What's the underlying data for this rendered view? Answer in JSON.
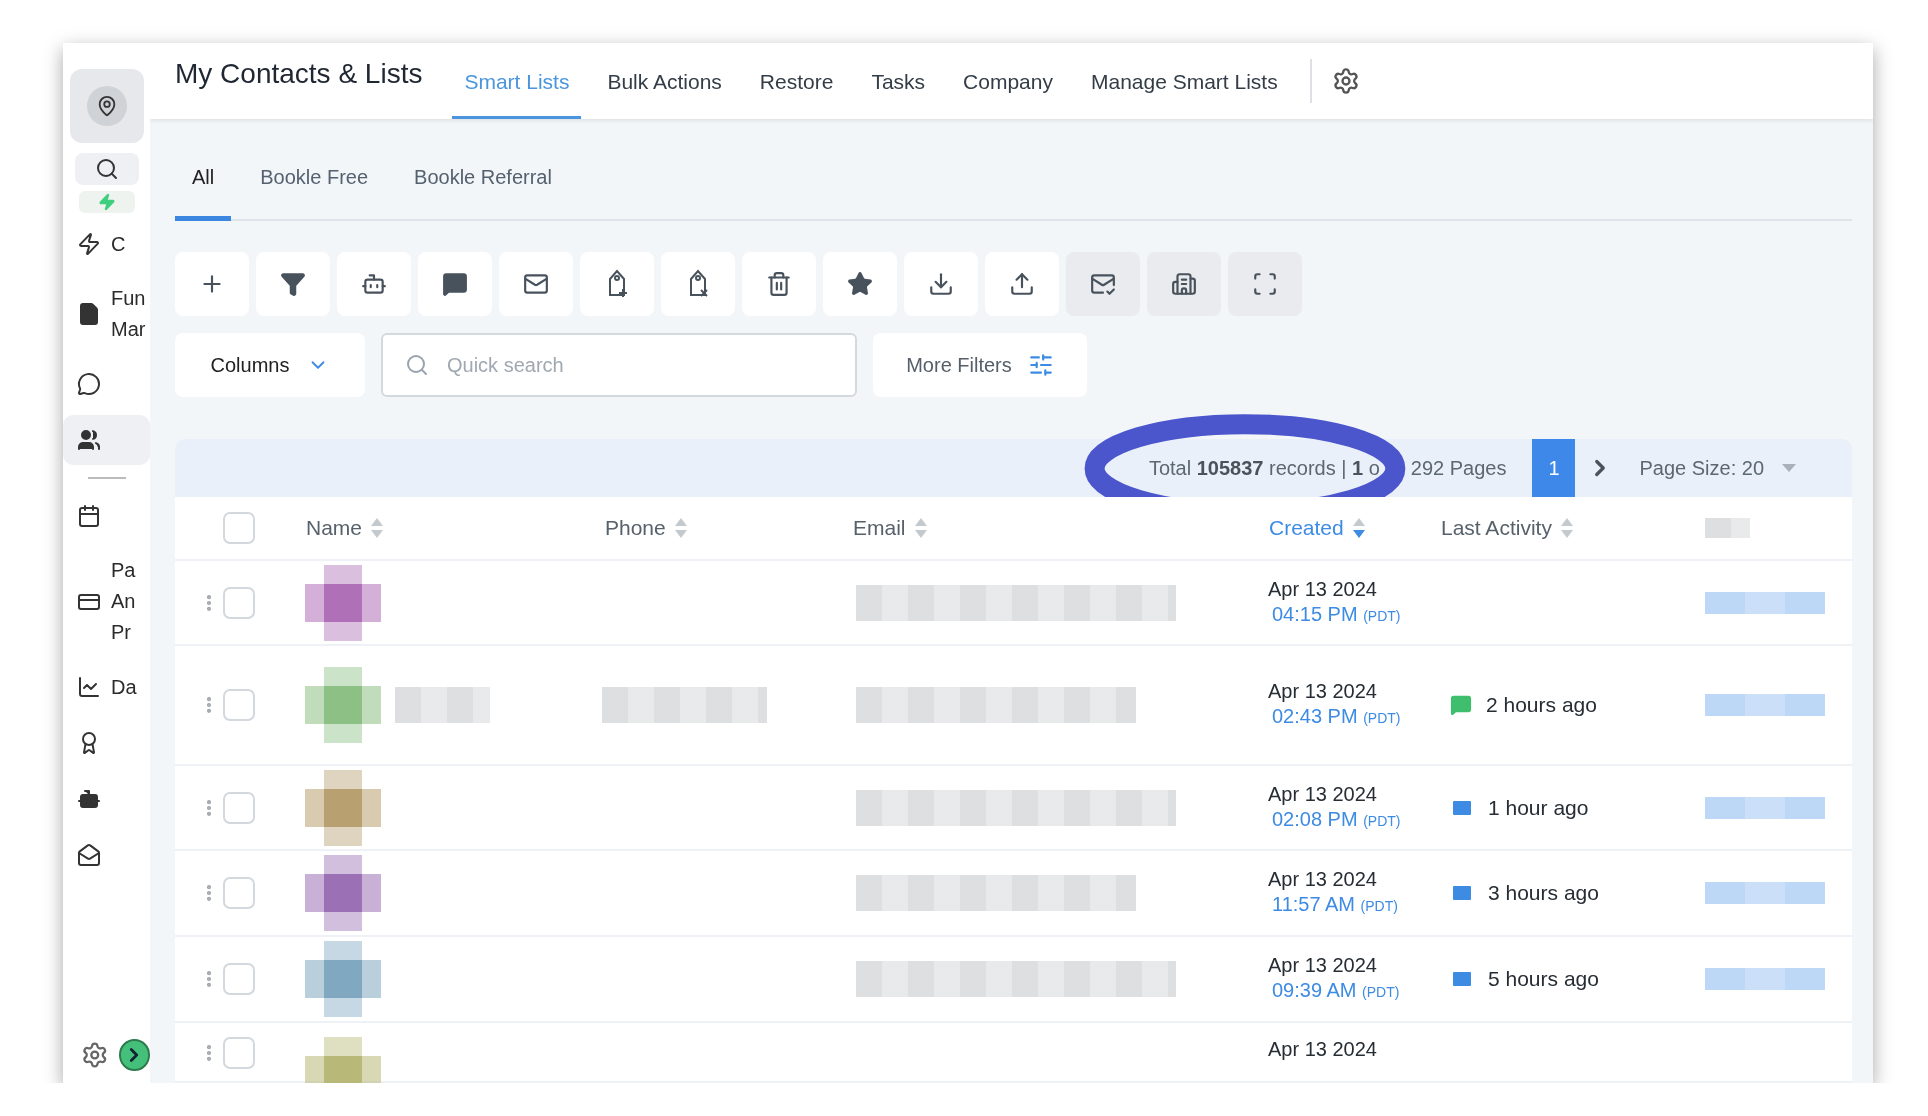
{
  "sidebar": {
    "nav": [
      {
        "lines": [
          "C"
        ],
        "selected": false
      },
      {
        "lines": [
          "Fun",
          "Mar"
        ],
        "selected": false
      },
      {
        "selected": false
      },
      {
        "selected": true
      },
      {
        "selected": false
      },
      {
        "lines": [
          "Pa",
          "An",
          "Pr"
        ],
        "selected": false
      },
      {
        "lines": [
          "Da"
        ],
        "selected": false
      },
      {
        "selected": false
      },
      {
        "selected": false
      },
      {
        "selected": false
      }
    ]
  },
  "header": {
    "title": "My Contacts & Lists",
    "tabs": [
      {
        "label": "Smart Lists",
        "selected": true
      },
      {
        "label": "Bulk Actions",
        "selected": false
      },
      {
        "label": "Restore",
        "selected": false
      },
      {
        "label": "Tasks",
        "selected": false
      },
      {
        "label": "Company",
        "selected": false
      },
      {
        "label": "Manage Smart Lists",
        "selected": false
      }
    ]
  },
  "list_tabs": [
    {
      "label": "All",
      "selected": true
    },
    {
      "label": "Bookle Free",
      "selected": false
    },
    {
      "label": "Bookle Referral",
      "selected": false
    }
  ],
  "toolbar": [
    {
      "shaded": false
    },
    {
      "shaded": false
    },
    {
      "shaded": false
    },
    {
      "shaded": false
    },
    {
      "shaded": false
    },
    {
      "shaded": false
    },
    {
      "shaded": false
    },
    {
      "shaded": false
    },
    {
      "shaded": false
    },
    {
      "shaded": false
    },
    {
      "shaded": false
    },
    {
      "shaded": true
    },
    {
      "shaded": true
    },
    {
      "shaded": true
    }
  ],
  "filters": {
    "columns_label": "Columns",
    "search_placeholder": "Quick search",
    "more_filters": "More Filters"
  },
  "pagination": {
    "summary": "Total **105837** records | **1** o",
    "pages": "292 Pages",
    "page": "1",
    "page_size": "Page Size: 20"
  },
  "annotation": {
    "kind": "ellipse"
  },
  "table": {
    "select_all_checked": false,
    "columns": [
      {
        "label": "Name",
        "sorted": false
      },
      {
        "label": "Phone",
        "sorted": false
      },
      {
        "label": "Email",
        "sorted": false
      },
      {
        "label": "Created",
        "sorted": true
      },
      {
        "label": "Last Activity",
        "sorted": false
      }
    ],
    "rows": [
      {
        "checked": false,
        "color": "#b070b8",
        "date": "Apr 13 2024",
        "time": "04:15 PM",
        "tz": "(PDT)"
      },
      {
        "checked": false,
        "color": "#8cc084",
        "name_redacted": true,
        "phone_redacted": true,
        "date": "Apr 13 2024",
        "time": "02:43 PM",
        "tz": "(PDT)",
        "activity": {
          "kind": "sms",
          "text": "2 hours ago"
        }
      },
      {
        "checked": false,
        "color": "#b8a070",
        "date": "Apr 13 2024",
        "time": "02:08 PM",
        "tz": "(PDT)",
        "activity": {
          "kind": "email",
          "text": "1 hour ago"
        }
      },
      {
        "checked": false,
        "color": "#9c70b4",
        "date": "Apr 13 2024",
        "time": "11:57 AM",
        "tz": "(PDT)",
        "activity": {
          "kind": "email",
          "text": "3 hours ago"
        }
      },
      {
        "checked": false,
        "color": "#80a8c0",
        "date": "Apr 13 2024",
        "time": "09:39 AM",
        "tz": "(PDT)",
        "activity": {
          "kind": "email",
          "text": "5 hours ago"
        }
      },
      {
        "checked": false,
        "color": "#b8b878",
        "date": "Apr 13 2024"
      }
    ]
  }
}
